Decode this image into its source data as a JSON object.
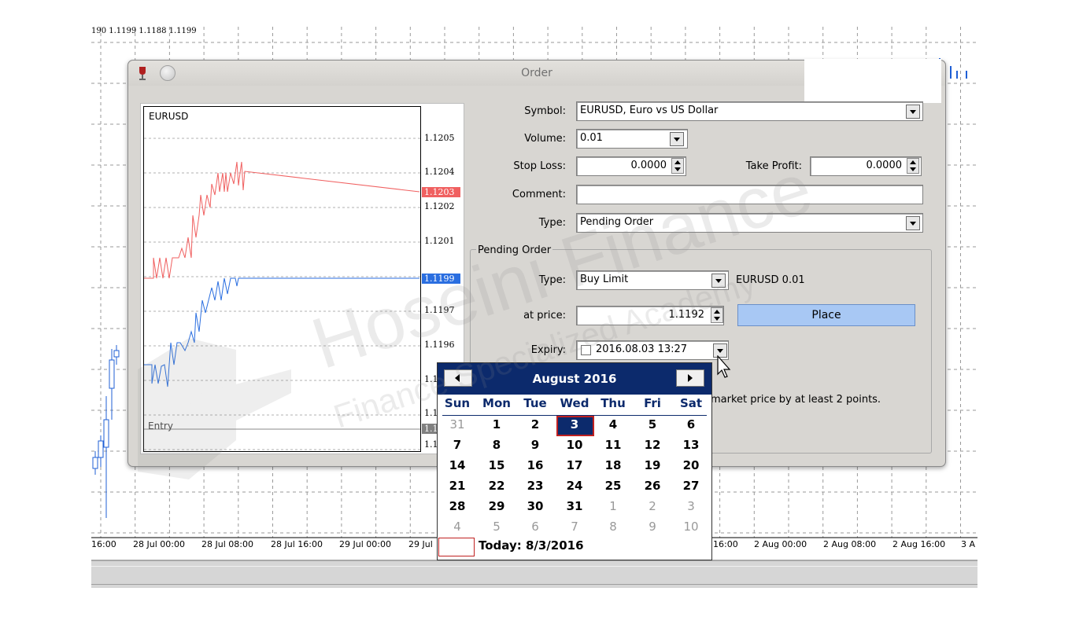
{
  "background_chart": {
    "header_text": "190 1.1199 1.1188 1.1199",
    "x_ticks": [
      "16:00",
      "28 Jul 00:00",
      "28 Jul 08:00",
      "28 Jul 16:00",
      "29 Jul 00:00",
      "29 Jul",
      "16:00",
      "2 Aug 00:00",
      "2 Aug 08:00",
      "2 Aug 16:00",
      "3 A"
    ]
  },
  "dialog": {
    "title": "Order",
    "chart": {
      "symbol": "EURUSD",
      "entry_label": "Entry",
      "price_labels": [
        "1.1205",
        "1.1204",
        "1.1202",
        "1.1201",
        "1.1197",
        "1.1196",
        "1.1",
        "1.1",
        "1.1"
      ],
      "ask_tag": "1.1203",
      "bid_tag": "1.1199",
      "entry_tag": "1.1",
      "ask_color": "#f06060",
      "bid_color": "#2a6ee0"
    },
    "symbol_label": "Symbol:",
    "symbol_value": "EURUSD, Euro vs US Dollar",
    "volume_label": "Volume:",
    "volume_value": "0.01",
    "stop_loss_label": "Stop Loss:",
    "stop_loss_value": "0.0000",
    "take_profit_label": "Take Profit:",
    "take_profit_value": "0.0000",
    "comment_label": "Comment:",
    "comment_value": "",
    "type_label": "Type:",
    "type_value": "Pending Order",
    "pending": {
      "group_title": "Pending Order",
      "type_label": "Type:",
      "type_value": "Buy Limit",
      "summary": "EURUSD 0.01",
      "price_label": "at price:",
      "price_value": "1.1192",
      "place_label": "Place",
      "expiry_label": "Expiry:",
      "expiry_value": "2016.08.03 13:27",
      "expiry_checked": false,
      "note": "market price by at least 2 points."
    }
  },
  "calendar": {
    "month_label": "August 2016",
    "weekdays": [
      "Sun",
      "Mon",
      "Tue",
      "Wed",
      "Thu",
      "Fri",
      "Sat"
    ],
    "weeks": [
      [
        {
          "d": "31",
          "m": true
        },
        {
          "d": "1"
        },
        {
          "d": "2"
        },
        {
          "d": "3",
          "sel": true
        },
        {
          "d": "4"
        },
        {
          "d": "5"
        },
        {
          "d": "6"
        }
      ],
      [
        {
          "d": "7"
        },
        {
          "d": "8"
        },
        {
          "d": "9"
        },
        {
          "d": "10"
        },
        {
          "d": "11"
        },
        {
          "d": "12"
        },
        {
          "d": "13"
        }
      ],
      [
        {
          "d": "14"
        },
        {
          "d": "15"
        },
        {
          "d": "16"
        },
        {
          "d": "17"
        },
        {
          "d": "18"
        },
        {
          "d": "19"
        },
        {
          "d": "20"
        }
      ],
      [
        {
          "d": "21"
        },
        {
          "d": "22"
        },
        {
          "d": "23"
        },
        {
          "d": "24"
        },
        {
          "d": "25"
        },
        {
          "d": "26"
        },
        {
          "d": "27"
        }
      ],
      [
        {
          "d": "28"
        },
        {
          "d": "29"
        },
        {
          "d": "30"
        },
        {
          "d": "31"
        },
        {
          "d": "1",
          "m": true
        },
        {
          "d": "2",
          "m": true
        },
        {
          "d": "3",
          "m": true
        }
      ],
      [
        {
          "d": "4",
          "m": true
        },
        {
          "d": "5",
          "m": true
        },
        {
          "d": "6",
          "m": true
        },
        {
          "d": "7",
          "m": true
        },
        {
          "d": "8",
          "m": true
        },
        {
          "d": "9",
          "m": true
        },
        {
          "d": "10",
          "m": true
        }
      ]
    ],
    "today_label": "Today: 8/3/2016"
  },
  "watermark": {
    "line1": "Hoseini Finance",
    "line2": "Finance Specialized Academy"
  }
}
